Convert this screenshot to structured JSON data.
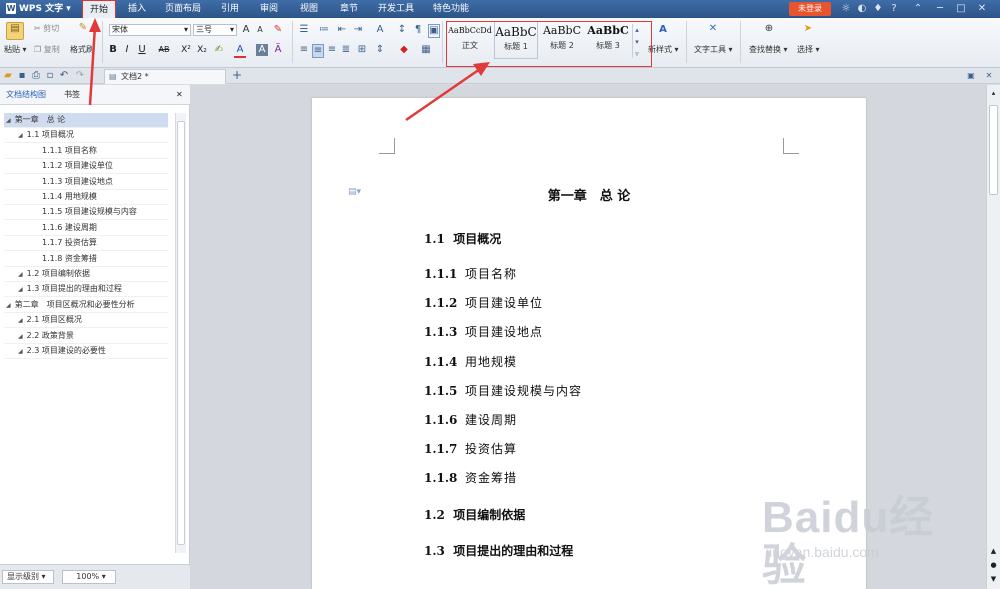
{
  "app": {
    "name": "WPS 文字",
    "logo_letter": "W"
  },
  "menu": {
    "tabs": [
      "开始",
      "插入",
      "页面布局",
      "引用",
      "审阅",
      "视图",
      "章节",
      "开发工具",
      "特色功能"
    ],
    "login": "未登录"
  },
  "ribbon": {
    "paste": "粘贴",
    "cut": "剪切",
    "copy": "复制",
    "format_painter": "格式刷",
    "font_name": "宋体",
    "font_size": "三号",
    "styles": [
      {
        "preview": "AaBbCcDd",
        "label": "正文"
      },
      {
        "preview": "AaBbC",
        "label": "标题 1"
      },
      {
        "preview": "AaBbC",
        "label": "标题 2"
      },
      {
        "preview": "AaBbC",
        "label": "标题 3"
      }
    ],
    "new_style": "新样式",
    "text_tools": "文字工具",
    "find_replace": "查找替换",
    "select": "选择"
  },
  "doc_tab": {
    "title": "文档2 *"
  },
  "left_panel": {
    "tab_outline": "文档结构图",
    "tab_bookmarks": "书签",
    "tree": [
      {
        "text": "第一章　总 论",
        "level": 0,
        "selected": true
      },
      {
        "text": "1.1  项目概况",
        "level": 1
      },
      {
        "text": "1.1.1  项目名称",
        "level": 2
      },
      {
        "text": "1.1.2  项目建设单位",
        "level": 2
      },
      {
        "text": "1.1.3  项目建设地点",
        "level": 2
      },
      {
        "text": "1.1.4  用地规模",
        "level": 2
      },
      {
        "text": "1.1.5  项目建设规模与内容",
        "level": 2
      },
      {
        "text": "1.1.6  建设周期",
        "level": 2
      },
      {
        "text": "1.1.7  投资估算",
        "level": 2
      },
      {
        "text": "1.1.8  资金筹措",
        "level": 2
      },
      {
        "text": "1.2  项目编制依据",
        "level": 1
      },
      {
        "text": "1.3  项目提出的理由和过程",
        "level": 1
      },
      {
        "text": "第二章　项目区概况和必要性分析",
        "level": 0
      },
      {
        "text": "2.1  项目区概况",
        "level": 1
      },
      {
        "text": "2.2  政策背景",
        "level": 1
      },
      {
        "text": "2.3  项目建设的必要性",
        "level": 1
      }
    ]
  },
  "status": {
    "display_level": "显示级别",
    "zoom": "100%"
  },
  "document": {
    "chapter_title": "第一章　总 论",
    "h2_1": {
      "num": "1.1",
      "text": "项目概况"
    },
    "h3": [
      {
        "num": "1.1.1",
        "text": "项目名称"
      },
      {
        "num": "1.1.2",
        "text": "项目建设单位"
      },
      {
        "num": "1.1.3",
        "text": "项目建设地点"
      },
      {
        "num": "1.1.4",
        "text": "用地规模"
      },
      {
        "num": "1.1.5",
        "text": "项目建设规模与内容"
      },
      {
        "num": "1.1.6",
        "text": "建设周期"
      },
      {
        "num": "1.1.7",
        "text": "投资估算"
      },
      {
        "num": "1.1.8",
        "text": "资金筹措"
      }
    ],
    "h2_2": {
      "num": "1.2",
      "text": "项目编制依据"
    },
    "h2_3": {
      "num": "1.3",
      "text": "项目提出的理由和过程"
    }
  },
  "watermark": {
    "logo": "Baidu经验",
    "url": "jingyan.baidu.com"
  },
  "colors": {
    "accent": "#2c5488",
    "annotation": "#e03a3a",
    "login": "#e8542e"
  }
}
